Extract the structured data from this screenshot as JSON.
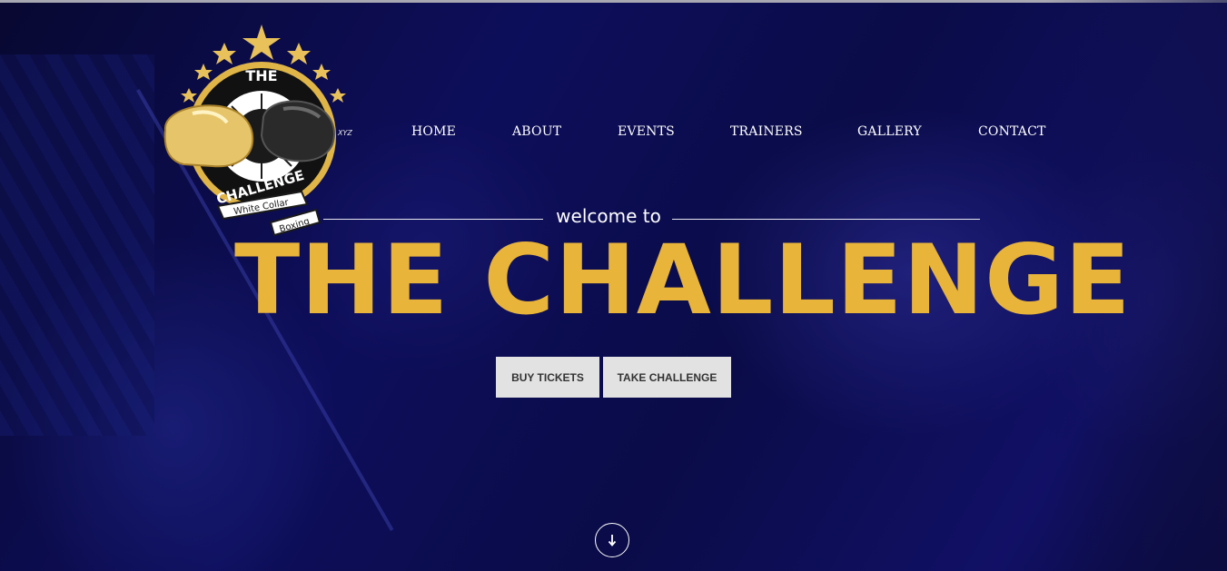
{
  "logo": {
    "top_text": "THE",
    "ring_text": "CHALLENGE",
    "ribbon_line1": "White Collar",
    "ribbon_line2": "Boxing",
    "glove_text": "XYZ",
    "icon": "boxing-gloves-logo"
  },
  "nav": {
    "items": [
      "HOME",
      "ABOUT",
      "EVENTS",
      "TRAINERS",
      "GALLERY",
      "CONTACT"
    ]
  },
  "hero": {
    "welcome": "welcome to",
    "title": "THE CHALLENGE"
  },
  "buttons": {
    "buy": "BUY TICKETS",
    "challenge": "TAKE CHALLENGE"
  },
  "scroll": {
    "icon": "arrow-down-icon"
  },
  "colors": {
    "accent": "#e8b43a",
    "button_bg": "#e2e2e2",
    "background": "#12137a"
  }
}
